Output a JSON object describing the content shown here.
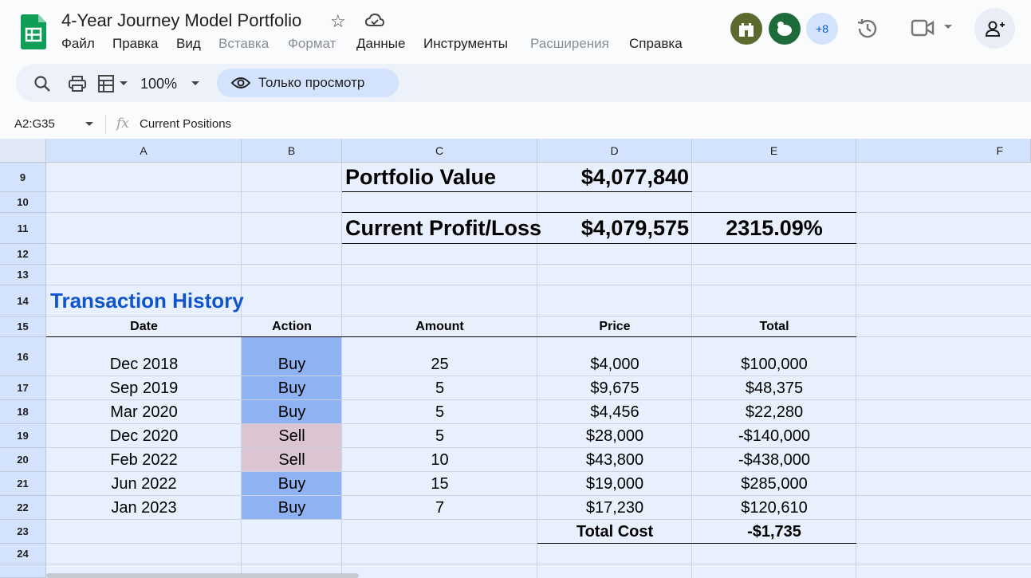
{
  "header": {
    "title": "4-Year Journey Model Portfolio",
    "menu": [
      "Файл",
      "Правка",
      "Вид",
      "Вставка",
      "Формат",
      "Данные",
      "Инструменты",
      "Расширения",
      "Справка"
    ],
    "more_users": "+8"
  },
  "toolbar": {
    "zoom": "100%",
    "view_only": "Только просмотр"
  },
  "formula_bar": {
    "range": "A2:G35",
    "fx": "fx",
    "content": "Current Positions"
  },
  "columns": [
    "A",
    "B",
    "C",
    "D",
    "E",
    "F"
  ],
  "rows": [
    "9",
    "10",
    "11",
    "12",
    "13",
    "14",
    "15",
    "16",
    "17",
    "18",
    "19",
    "20",
    "21",
    "22",
    "23",
    "24"
  ],
  "summary": {
    "portfolio_value_label": "Portfolio Value",
    "portfolio_value": "$4,077,840",
    "profit_loss_label": "Current Profit/Loss",
    "profit_loss": "$4,079,575",
    "profit_loss_pct": "2315.09%"
  },
  "transactions": {
    "title": "Transaction History",
    "headers": [
      "Date",
      "Action",
      "Amount",
      "Price",
      "Total"
    ],
    "rows": [
      [
        "Dec 2018",
        "Buy",
        "25",
        "$4,000",
        "$100,000"
      ],
      [
        "Sep 2019",
        "Buy",
        "5",
        "$9,675",
        "$48,375"
      ],
      [
        "Mar 2020",
        "Buy",
        "5",
        "$4,456",
        "$22,280"
      ],
      [
        "Dec 2020",
        "Sell",
        "5",
        "$28,000",
        "-$140,000"
      ],
      [
        "Feb 2022",
        "Sell",
        "10",
        "$43,800",
        "-$438,000"
      ],
      [
        "Jun 2022",
        "Buy",
        "15",
        "$19,000",
        "$285,000"
      ],
      [
        "Jan 2023",
        "Buy",
        "7",
        "$17,230",
        "$120,610"
      ]
    ],
    "total_label": "Total Cost",
    "total_value": "-$1,735"
  },
  "colors": {
    "buy": "#8fb2f2",
    "sell": "#dcc5d3",
    "title_blue": "#1155cc"
  }
}
